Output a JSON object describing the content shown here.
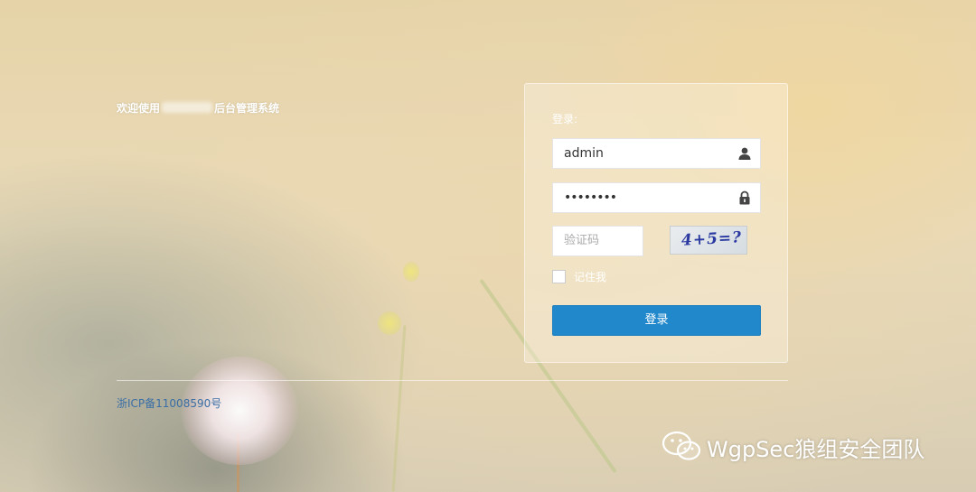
{
  "welcome": {
    "prefix": "欢迎使用",
    "suffix": "后台管理系统"
  },
  "login_panel": {
    "title": "登录:",
    "username": {
      "value": "admin",
      "icon": "user-icon"
    },
    "password": {
      "value": "••••••••",
      "icon": "lock-icon"
    },
    "captcha": {
      "placeholder": "验证码",
      "image_text": "4+5=?"
    },
    "remember_label": "记住我",
    "remember_checked": false,
    "submit_label": "登录"
  },
  "footer": {
    "icp": "浙ICP备11008590号"
  },
  "watermark": {
    "text": "WgpSec狼组安全团队",
    "icon": "wechat-icon"
  },
  "colors": {
    "button_blue": "#2188cb",
    "icp_link": "#3a6ea5",
    "captcha_text": "#2b3aa0"
  }
}
